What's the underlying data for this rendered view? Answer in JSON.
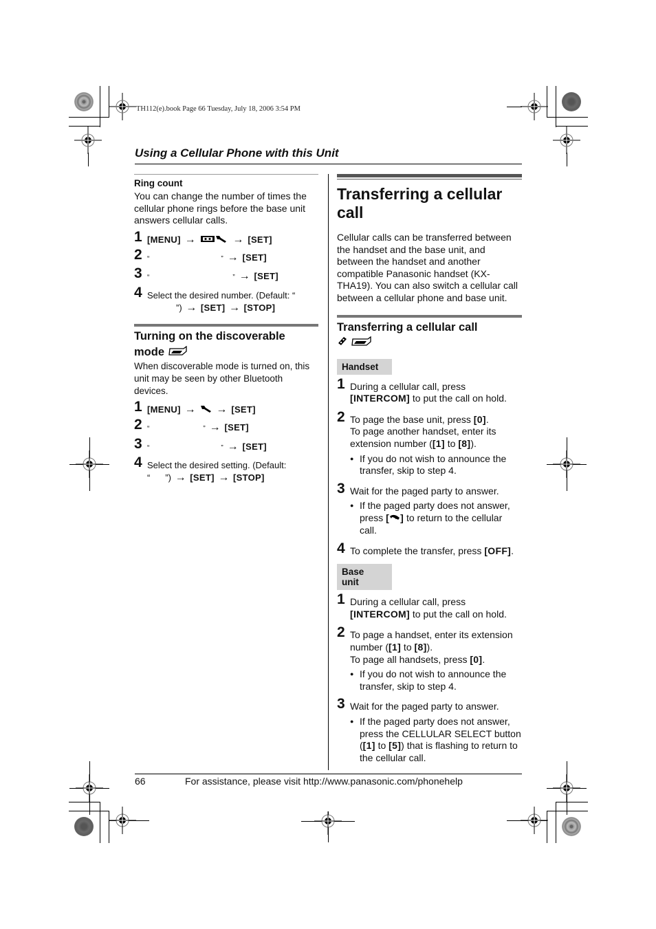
{
  "slug": "TH112(e).book  Page 66  Tuesday, July 18, 2006  3:54 PM",
  "running_head": "Using a Cellular Phone with this Unit",
  "left_column": {
    "ring_count": {
      "title": "Ring count",
      "description": "You can change the number of times the cellular phone rings before the base unit answers cellular calls.",
      "steps": [
        {
          "num": "1",
          "parts": {
            "k1": "[MENU]",
            "k2": "[SET]"
          },
          "icon": "answering-system-settings-icon"
        },
        {
          "num": "2",
          "open_q": "“",
          "close_q": "”",
          "k1": "[SET]"
        },
        {
          "num": "3",
          "open_q": "“",
          "close_q": "”",
          "k1": "[SET]"
        },
        {
          "num": "4",
          "text": "Select the desired number. (Default: “",
          "text2": "”)",
          "k1": "[SET]",
          "k2": "[STOP]"
        }
      ]
    },
    "discoverable": {
      "title": "Turning on the discoverable mode",
      "icon": "base-unit-icon",
      "description": "When discoverable mode is turned on, this unit may be seen by other Bluetooth devices.",
      "steps": [
        {
          "num": "1",
          "k1": "[MENU]",
          "k2": "[SET]",
          "icon": "wrench-icon"
        },
        {
          "num": "2",
          "open_q": "“",
          "close_q": "”",
          "k1": "[SET]"
        },
        {
          "num": "3",
          "open_q": "“",
          "close_q": "”",
          "k1": "[SET]"
        },
        {
          "num": "4",
          "text": "Select the desired setting. (Default:",
          "text2_open": "“",
          "text2_close": "”)",
          "k1": "[SET]",
          "k2": "[STOP]"
        }
      ]
    }
  },
  "right_column": {
    "title": "Transferring a cellular call",
    "intro": "Cellular calls can be transferred between the handset and the base unit, and between the handset and another compatible Panasonic handset (KX-THA19). You can also switch a cellular call between a cellular phone and base unit.",
    "subsection_title": "Transferring a cellular call",
    "handset": {
      "label": "Handset",
      "steps": [
        {
          "num": "1",
          "t1": "During a cellular call, press",
          "k1": "[INTERCOM]",
          "t2": " to put the call on hold."
        },
        {
          "num": "2",
          "t1": "To page the base unit, press ",
          "k1": "[0]",
          "t2": ".",
          "t3": "To page another handset, enter its extension number (",
          "k2": "[1]",
          "t4": " to ",
          "k3": "[8]",
          "t5": ").",
          "bullet": "If you do not wish to announce the transfer, skip to step 4."
        },
        {
          "num": "3",
          "t1": "Wait for the paged party to answer.",
          "bullet_pre": "If the paged party does not answer, press ",
          "bullet_key_open": "[",
          "bullet_key_close": "]",
          "bullet_post": " to return to the cellular call."
        },
        {
          "num": "4",
          "t1": "To complete the transfer, press ",
          "k1": "[OFF]",
          "t2": "."
        }
      ]
    },
    "base_unit": {
      "label": "Base unit",
      "steps": [
        {
          "num": "1",
          "t1": "During a cellular call, press",
          "k1": "[INTERCOM]",
          "t2": " to put the call on hold."
        },
        {
          "num": "2",
          "t1": "To page a handset, enter its extension number (",
          "k1": "[1]",
          "t2": " to ",
          "k2": "[8]",
          "t3": ").",
          "t4": "To page all handsets, press ",
          "k3": "[0]",
          "t5": ".",
          "bullet": "If you do not wish to announce the transfer, skip to step 4."
        },
        {
          "num": "3",
          "t1": "Wait for the paged party to answer.",
          "bullet_pre": "If the paged party does not answer, press the CELLULAR SELECT button (",
          "bk1": "[1]",
          "bmid": " to ",
          "bk2": "[5]",
          "bullet_post": ") that is flashing to return to the cellular call."
        }
      ]
    }
  },
  "footer": {
    "page_number": "66",
    "text": "For assistance, please visit http://www.panasonic.com/phonehelp"
  },
  "symbols": {
    "arrow": "→"
  }
}
